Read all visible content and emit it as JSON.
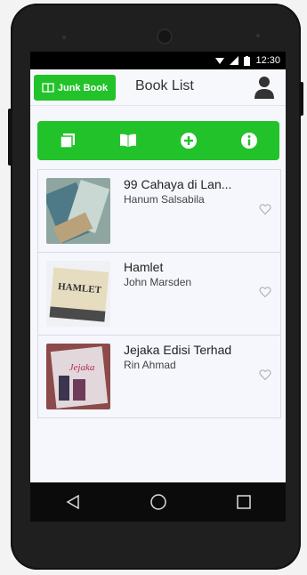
{
  "status": {
    "time": "12:30"
  },
  "appbar": {
    "brand_label": "Junk Book",
    "title": "Book List"
  },
  "toolbar": {
    "icons": [
      "stack-icon",
      "book-open-icon",
      "plus-circle-icon",
      "info-icon"
    ]
  },
  "books": [
    {
      "title": "99 Cahaya di Lan...",
      "author": "Hanum Salsabila",
      "cover_text": ""
    },
    {
      "title": "Hamlet",
      "author": "John Marsden",
      "cover_text": "HAMLET"
    },
    {
      "title": "Jejaka Edisi Terhad",
      "author": "Rin Ahmad",
      "cover_text": "Jejaka"
    }
  ],
  "colors": {
    "accent": "#22c32a",
    "screen_bg": "#f5f7fd",
    "phone": "#1f1f1f"
  }
}
